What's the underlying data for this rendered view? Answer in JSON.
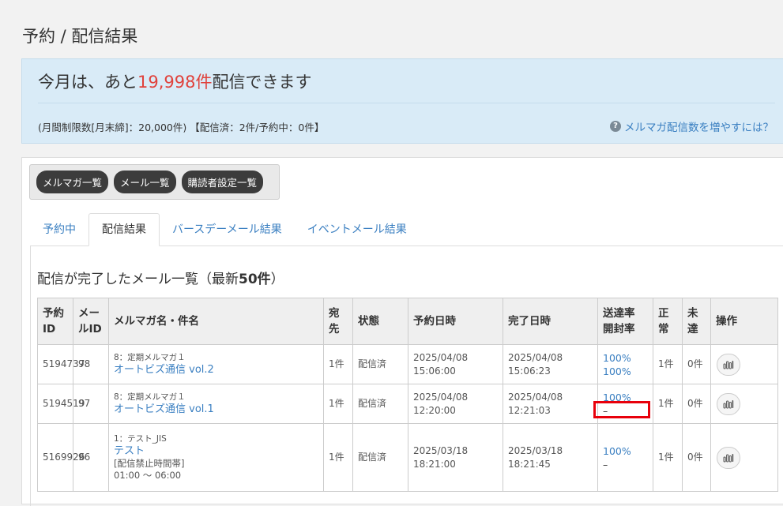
{
  "page": {
    "title": "予約 / 配信結果"
  },
  "info": {
    "headline_prefix": "今月は、あと",
    "headline_count": "19,998件",
    "headline_suffix": "配信できます",
    "limit_text": "(月間制限数[月末締]：20,000件) 【配信済：2件/予約中：0件】",
    "help_link": "メルマガ配信数を増やすには？"
  },
  "buttons": {
    "magazine_list": "メルマガ一覧",
    "mail_list": "メール一覧",
    "subscriber_settings": "購読者設定一覧"
  },
  "tabs": [
    {
      "label": "予約中"
    },
    {
      "label": "配信結果"
    },
    {
      "label": "バースデーメール結果"
    },
    {
      "label": "イベントメール結果"
    }
  ],
  "section": {
    "title_prefix": "配信が完了したメール一覧（最新",
    "title_count": "50件",
    "title_suffix": "）"
  },
  "table": {
    "headers": {
      "reserve_id": "予約ID",
      "mail_id": "メールID",
      "name": "メルマガ名・件名",
      "recipients": "宛先",
      "status": "状態",
      "reserve_date": "予約日時",
      "complete_date": "完了日時",
      "delivery_rate": "送達率",
      "open_rate": "開封率",
      "normal": "正常",
      "undelivered": "未達",
      "operation": "操作"
    },
    "rows": [
      {
        "reserve_id": "5194737",
        "mail_id": "98",
        "magazine": "8：定期メルマガ１",
        "subject": "オートビズ通信 vol.2",
        "note1": "",
        "note2": "",
        "recipients": "1件",
        "status": "配信済",
        "reserve_date": "2025/04/08",
        "reserve_time": "15:06:00",
        "complete_date": "2025/04/08",
        "complete_time": "15:06:23",
        "delivery_rate": "100%",
        "open_rate": "100%",
        "normal": "1件",
        "undelivered": "0件"
      },
      {
        "reserve_id": "5194519",
        "mail_id": "97",
        "magazine": "8：定期メルマガ１",
        "subject": "オートビズ通信 vol.1",
        "note1": "",
        "note2": "",
        "recipients": "1件",
        "status": "配信済",
        "reserve_date": "2025/04/08",
        "reserve_time": "12:20:00",
        "complete_date": "2025/04/08",
        "complete_time": "12:21:03",
        "delivery_rate": "100%",
        "open_rate": "–",
        "normal": "1件",
        "undelivered": "0件"
      },
      {
        "reserve_id": "5169926",
        "mail_id": "96",
        "magazine": "1：テスト_JIS",
        "subject": "テスト",
        "note1": "[配信禁止時間帯]",
        "note2": "01:00 ～ 06:00",
        "recipients": "1件",
        "status": "配信済",
        "reserve_date": "2025/03/18",
        "reserve_time": "18:21:00",
        "complete_date": "2025/03/18",
        "complete_time": "18:21:45",
        "delivery_rate": "100%",
        "open_rate": "–",
        "normal": "1件",
        "undelivered": "0件"
      }
    ]
  },
  "colors": {
    "accent_link": "#3a7fc1",
    "count_red": "#e0423c",
    "info_bg": "#d9ebf7",
    "highlight_red": "#e8000b"
  },
  "icons": {
    "stats": "bar-chart-icon",
    "help": "question-circle-icon"
  }
}
